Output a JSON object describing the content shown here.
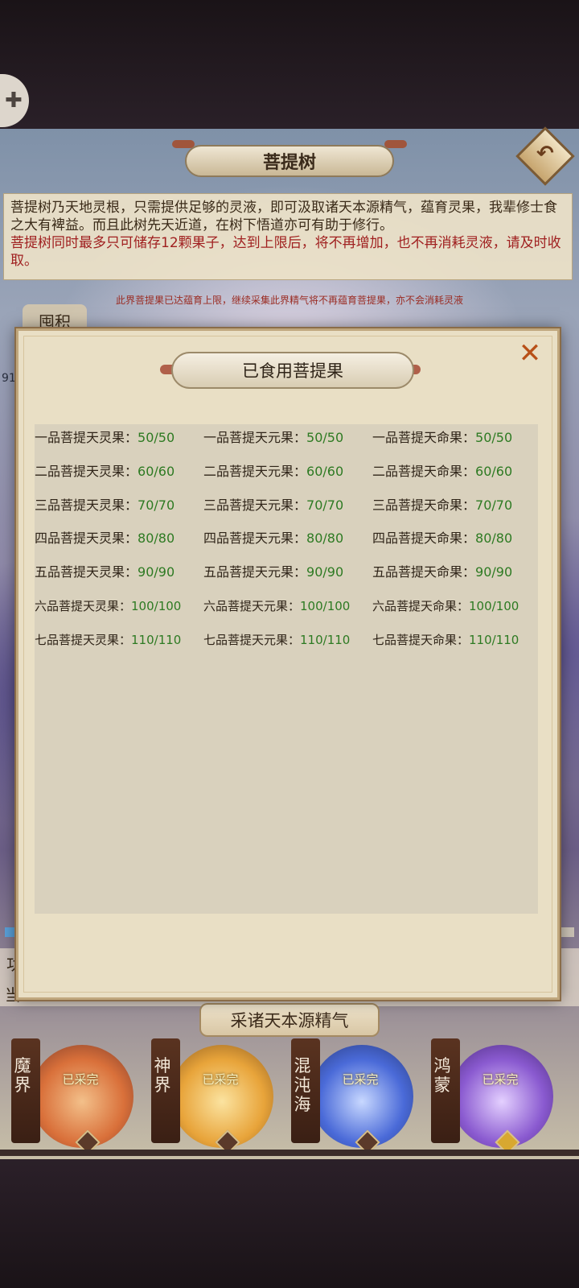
{
  "scene": {
    "title": "菩提树",
    "description": "菩提树乃天地灵根，只需提供足够的灵液，即可汲取诸天本源精气，蕴育灵果，我辈修士食之大有裨益。而且此树先天近道，在树下悟道亦可有助于修行。",
    "warning": "菩提树同时最多只可储存12颗果子，达到上限后，将不再增加，也不再消耗灵液，请及时收取。",
    "note": "此界菩提果已达蕴育上限，继续采集此界精气将不再蕴育菩提果，亦不会消耗灵液",
    "tag": "囤积",
    "side_number": "91",
    "band_label_1": "功",
    "band_label_2": "当",
    "collect_title": "采诸天本源精气",
    "realms": [
      {
        "name": "魔界",
        "state": "已采完",
        "color": "#d9703a"
      },
      {
        "name": "神界",
        "state": "已采完",
        "color": "#e8a43a"
      },
      {
        "name": "混沌海",
        "state": "已采完",
        "color": "#4a6ad8"
      },
      {
        "name": "鸿蒙",
        "state": "已采完",
        "color": "#8a5ad0"
      }
    ]
  },
  "modal": {
    "title": "已食用菩提果",
    "close_icon": "close-icon",
    "rows": [
      [
        {
          "name": "一品菩提天灵果：",
          "value": "50/50"
        },
        {
          "name": "一品菩提天元果：",
          "value": "50/50"
        },
        {
          "name": "一品菩提天命果：",
          "value": "50/50"
        }
      ],
      [
        {
          "name": "二品菩提天灵果：",
          "value": "60/60"
        },
        {
          "name": "二品菩提天元果：",
          "value": "60/60"
        },
        {
          "name": "二品菩提天命果：",
          "value": "60/60"
        }
      ],
      [
        {
          "name": "三品菩提天灵果：",
          "value": "70/70"
        },
        {
          "name": "三品菩提天元果：",
          "value": "70/70"
        },
        {
          "name": "三品菩提天命果：",
          "value": "70/70"
        }
      ],
      [
        {
          "name": "四品菩提天灵果：",
          "value": "80/80"
        },
        {
          "name": "四品菩提天元果：",
          "value": "80/80"
        },
        {
          "name": "四品菩提天命果：",
          "value": "80/80"
        }
      ],
      [
        {
          "name": "五品菩提天灵果：",
          "value": "90/90"
        },
        {
          "name": "五品菩提天元果：",
          "value": "90/90"
        },
        {
          "name": "五品菩提天命果：",
          "value": "90/90"
        }
      ],
      [
        {
          "name": "六品菩提天灵果：",
          "value": "100/100"
        },
        {
          "name": "六品菩提天元果：",
          "value": "100/100"
        },
        {
          "name": "六品菩提天命果：",
          "value": "100/100"
        }
      ],
      [
        {
          "name": "七品菩提天灵果：",
          "value": "110/110"
        },
        {
          "name": "七品菩提天元果：",
          "value": "110/110"
        },
        {
          "name": "七品菩提天命果：",
          "value": "110/110"
        }
      ]
    ]
  }
}
